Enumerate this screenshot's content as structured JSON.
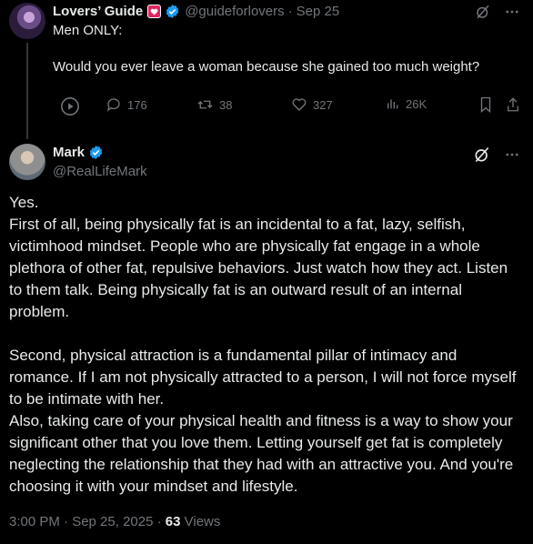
{
  "tweet1": {
    "author_name": "Lovers’ Guide",
    "handle": "@guideforlovers",
    "separator": "·",
    "date": "Sep 25",
    "text_line1": "Men ONLY:",
    "text_line2": "Would you ever leave a woman because she gained too much weight?",
    "actions": {
      "replies": "176",
      "retweets": "38",
      "likes": "327",
      "views": "26K"
    }
  },
  "tweet2": {
    "author_name": "Mark",
    "handle": "@RealLifeMark",
    "paragraph1": "Yes.\nFirst of all, being physically fat is an incidental to a fat, lazy, selfish, victimhood mindset. People who are physically fat engage in a whole plethora of other fat, repulsive behaviors. Just watch how they act. Listen to them talk. Being physically fat is an outward result of an internal problem.",
    "paragraph2": "Second, physical attraction is a fundamental pillar of intimacy and romance. If I am not physically attracted to a person, I will not force myself to be intimate with her.\nAlso, taking care of your physical health and fitness is a way to show your significant other that you love them. Letting yourself get fat is completely neglecting the relationship that they had with an attractive you. And you're choosing it with your mindset and lifestyle.",
    "timestamp": "3:00 PM · Sep 25, 2025",
    "meta_sep": " · ",
    "views_count": "63",
    "views_label": " Views"
  },
  "colors": {
    "background": "#000000",
    "text": "#e7e9ea",
    "muted": "#71767b",
    "verified": "#1d9bf0",
    "heart_badge": "#e0245e"
  },
  "icons": [
    "heart-badge-icon",
    "verified-icon",
    "grok-icon",
    "more-icon",
    "play-icon",
    "reply-icon",
    "retweet-icon",
    "like-icon",
    "views-icon",
    "bookmark-icon",
    "share-icon"
  ]
}
